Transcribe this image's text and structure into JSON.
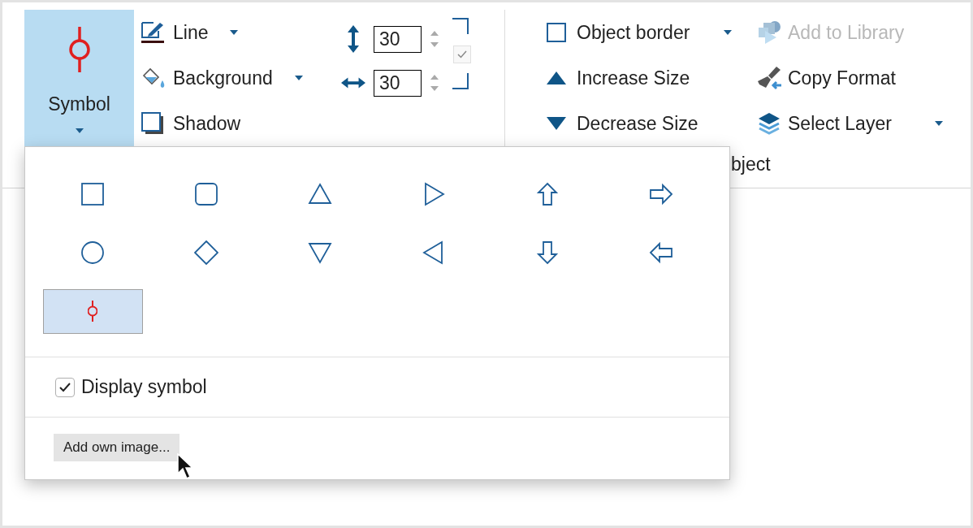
{
  "ribbon": {
    "symbol_button": {
      "label": "Symbol",
      "expanded": true
    },
    "format_items": [
      {
        "kind": "line",
        "label": "Line",
        "dropdown": true
      },
      {
        "kind": "background",
        "label": "Background",
        "dropdown": true
      },
      {
        "kind": "shadow",
        "label": "Shadow",
        "dropdown": false
      }
    ],
    "size_fields": [
      {
        "kind": "height",
        "value": "30"
      },
      {
        "kind": "width",
        "value": "30"
      }
    ],
    "keep_ratio": {
      "checked": true
    },
    "object_items": [
      {
        "kind": "border",
        "label": "Object border",
        "dropdown": true,
        "disabled": false
      },
      {
        "kind": "library",
        "label": "Add to Library",
        "dropdown": false,
        "disabled": true
      },
      {
        "kind": "increase",
        "label": "Increase Size",
        "dropdown": false,
        "disabled": false
      },
      {
        "kind": "copy-format",
        "label": "Copy Format",
        "dropdown": false,
        "disabled": false
      },
      {
        "kind": "decrease",
        "label": "Decrease Size",
        "dropdown": false,
        "disabled": false
      },
      {
        "kind": "layers",
        "label": "Select Layer",
        "dropdown": true,
        "disabled": false
      }
    ],
    "group_label": "bject"
  },
  "symbol_menu": {
    "symbols": [
      {
        "kind": "square",
        "selected": false
      },
      {
        "kind": "rounded-square",
        "selected": false
      },
      {
        "kind": "triangle-up",
        "selected": false
      },
      {
        "kind": "triangle-right",
        "selected": false
      },
      {
        "kind": "arrow-up",
        "selected": false
      },
      {
        "kind": "arrow-right",
        "selected": false
      },
      {
        "kind": "circle",
        "selected": false
      },
      {
        "kind": "diamond",
        "selected": false
      },
      {
        "kind": "triangle-down",
        "selected": false
      },
      {
        "kind": "triangle-left",
        "selected": false
      },
      {
        "kind": "arrow-down",
        "selected": false
      },
      {
        "kind": "arrow-left",
        "selected": false
      },
      {
        "kind": "line-circle",
        "selected": true
      }
    ],
    "display_symbol": {
      "label": "Display symbol",
      "checked": true
    },
    "add_button": "Add own image..."
  }
}
